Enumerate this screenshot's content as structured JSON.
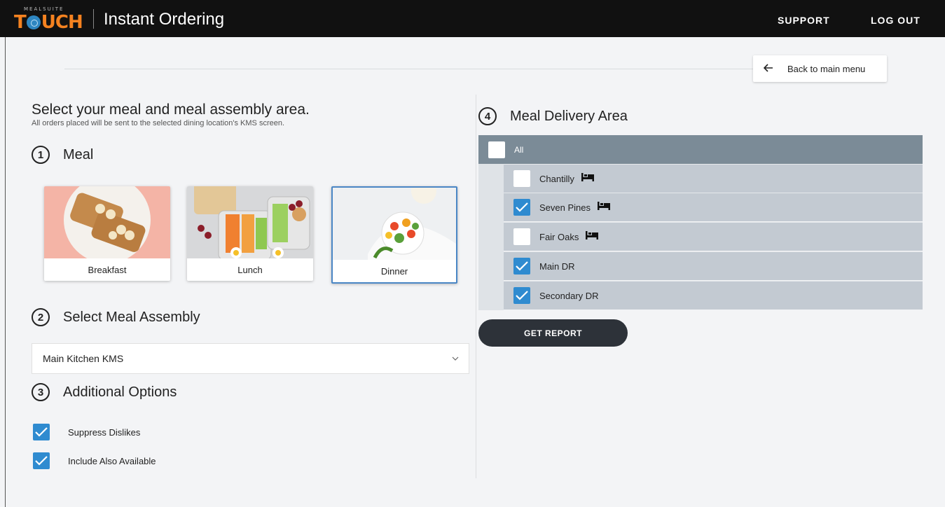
{
  "header": {
    "logo_small": "MEALSUITE",
    "logo_text_pre": "T",
    "logo_text_post": "UCH",
    "app_title": "Instant Ordering",
    "support_label": "SUPPORT",
    "logout_label": "LOG OUT"
  },
  "back_button": {
    "label": "Back to main menu",
    "icon": "arrow-left-icon"
  },
  "intro": {
    "heading": "Select your meal and meal assembly area.",
    "subheading": "All orders placed will be sent to the selected dining location's KMS screen."
  },
  "meal_section": {
    "number": "1",
    "title": "Meal",
    "cards": [
      {
        "label": "Breakfast",
        "selected": false
      },
      {
        "label": "Lunch",
        "selected": false
      },
      {
        "label": "Dinner",
        "selected": true
      }
    ]
  },
  "assembly_section": {
    "number": "2",
    "title": "Select Meal Assembly",
    "selected_value": "Main Kitchen KMS"
  },
  "options_section": {
    "number": "3",
    "title": "Additional Options",
    "options": [
      {
        "label": "Suppress Dislikes",
        "checked": true
      },
      {
        "label": "Include Also Available",
        "checked": true
      }
    ]
  },
  "delivery_section": {
    "number": "4",
    "title": "Meal Delivery Area",
    "all_label": "All",
    "all_checked": false,
    "areas": [
      {
        "label": "Chantilly",
        "checked": false,
        "icon": "bed-icon"
      },
      {
        "label": "Seven Pines",
        "checked": true,
        "icon": "bed-icon"
      },
      {
        "label": "Fair Oaks",
        "checked": false,
        "icon": "bed-icon"
      },
      {
        "label": "Main DR",
        "checked": true,
        "icon": ""
      },
      {
        "label": "Secondary DR",
        "checked": true,
        "icon": ""
      }
    ]
  },
  "report_button": {
    "label": "GET REPORT"
  },
  "colors": {
    "brand_orange": "#f58220",
    "check_blue": "#2f8bd0",
    "selected_border": "#4a86c5",
    "all_row": "#7b8b97",
    "area_row": "#c3cad2",
    "button_dark": "#2d3239"
  }
}
